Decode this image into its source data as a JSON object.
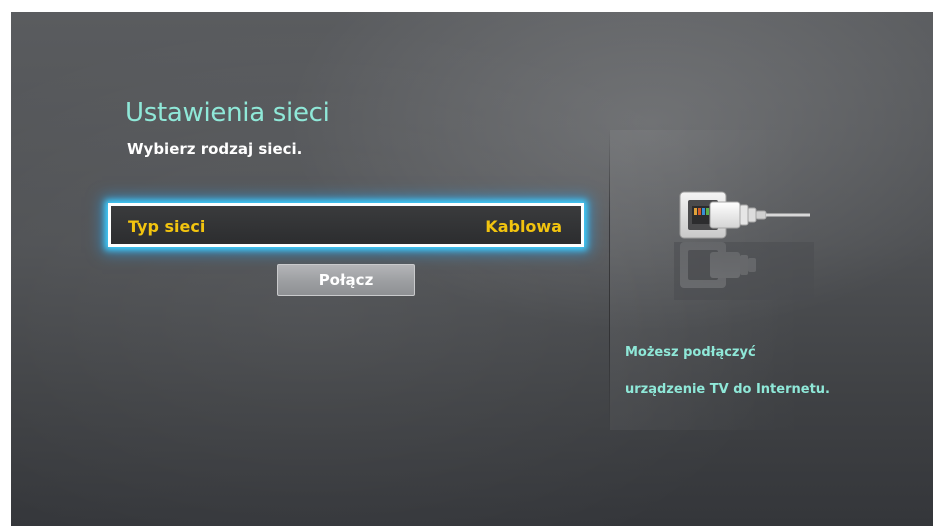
{
  "header": {
    "title": "Ustawienia sieci",
    "subtitle": "Wybierz rodzaj sieci."
  },
  "network_type": {
    "label": "Typ sieci",
    "value": "Kablowa"
  },
  "connect_button": {
    "label": "Połącz"
  },
  "info": {
    "line1": "Możesz podłączyć",
    "line2": "urządzenie TV do Internetu."
  },
  "illustration": {
    "icon": "ethernet-cable-icon"
  },
  "colors": {
    "title": "#8fe8d8",
    "selection_value": "#f2c40f",
    "focus_glow": "#3fd0ff"
  }
}
